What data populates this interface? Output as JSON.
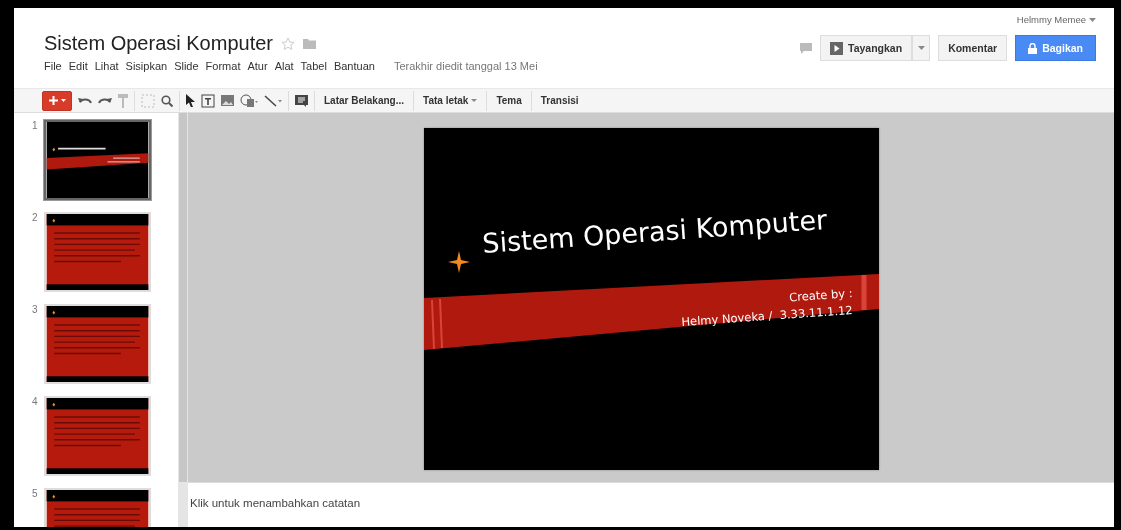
{
  "document": {
    "title": "Sistem Operasi Komputer",
    "starred": false
  },
  "menu": [
    "File",
    "Edit",
    "Lihat",
    "Sisipkan",
    "Slide",
    "Format",
    "Atur",
    "Alat",
    "Tabel",
    "Bantuan"
  ],
  "last_edit": "Terakhir diedit tanggal 13 Mei",
  "account": {
    "name": "Helmmy Memee"
  },
  "header_buttons": [
    {
      "label": "Tayangkan",
      "kind": "present"
    },
    {
      "label": "Komentar",
      "kind": "plain"
    },
    {
      "label": "Bagikan",
      "kind": "share"
    }
  ],
  "toolbar": {
    "buttons": [
      {
        "label": "Latar Belakang...",
        "kind": "plain"
      },
      {
        "label": "Tata letak",
        "kind": "dropdown"
      },
      {
        "label": "Tema",
        "kind": "plain"
      },
      {
        "label": "Transisi",
        "kind": "plain"
      }
    ]
  },
  "slides": [
    {
      "number": "1",
      "kind": "title",
      "selected": true
    },
    {
      "number": "2",
      "kind": "content",
      "selected": false
    },
    {
      "number": "3",
      "kind": "content",
      "selected": false
    },
    {
      "number": "4",
      "kind": "content",
      "selected": false
    },
    {
      "number": "5",
      "kind": "content",
      "selected": false
    }
  ],
  "canvas": {
    "title": "Sistem Operasi Komputer",
    "subtitle_lines": [
      "Create by :",
      "Helmy Noveka /  3.33.11.1.12"
    ]
  },
  "notes": {
    "placeholder": "Klik untuk menambahkan catatan"
  }
}
